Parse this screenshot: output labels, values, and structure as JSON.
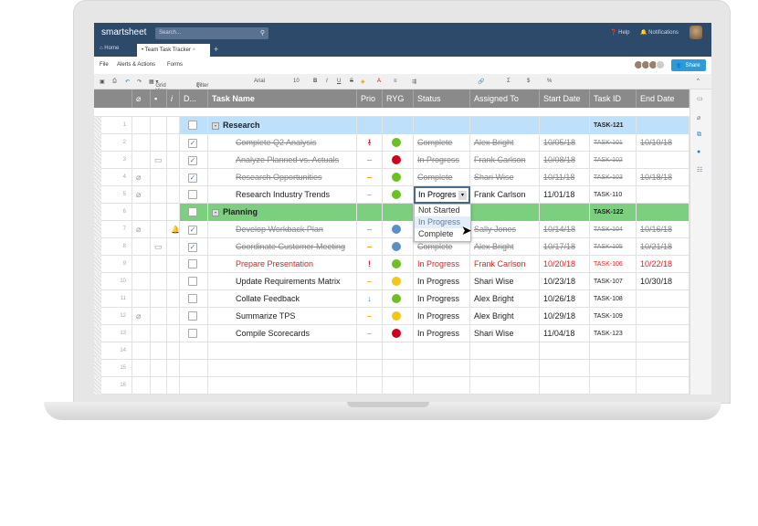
{
  "app": {
    "logo": "smartsheet",
    "search_placeholder": "Search...",
    "help": "Help",
    "notifications": "Notifications"
  },
  "tabs": {
    "home": "Home",
    "active": "Team Task Tracker",
    "add": "+"
  },
  "menu": [
    "File",
    "Alerts & Actions",
    "Forms"
  ],
  "share": "Share",
  "toolbar": {
    "view": "Grid View",
    "filter": "Filter",
    "font": "Arial",
    "size": "10"
  },
  "columns": [
    "D...",
    "Task Name",
    "Prio",
    "RYG",
    "Status",
    "Assigned To",
    "Start Date",
    "Task ID",
    "End Date"
  ],
  "colors": {
    "header": "#2e4a6a",
    "research_row": "#bfe0fb",
    "planning_row": "#7ccf7f",
    "share": "#2f9ad8",
    "green": "#6cc024",
    "red": "#d0021b",
    "yellow": "#f5c518",
    "blue": "#5b8fc7"
  },
  "rows": [
    {
      "n": "1",
      "task": "Research",
      "parent": "research",
      "task_id": "TASK-121"
    },
    {
      "n": "2",
      "task": "Complete Q2 Analysis",
      "done": true,
      "prio": "!",
      "ryg": "green",
      "status": "Complete",
      "assigned": "Alex Bright",
      "start": "10/05/18",
      "task_id": "TASK-101",
      "end": "10/10/18",
      "strike": true
    },
    {
      "n": "3",
      "task": "Analyze Planned vs. Actuals",
      "comment": true,
      "done": true,
      "prio": "–",
      "ryg": "red",
      "status": "In Progress",
      "assigned": "Frank Carlson",
      "start": "10/08/18",
      "task_id": "TASK-102",
      "end": "",
      "strike": true
    },
    {
      "n": "4",
      "task": "Research Opportunities",
      "attach": true,
      "done": true,
      "prio": "–",
      "ryg": "green",
      "status": "Complete",
      "assigned": "Shari Wise",
      "start": "10/11/18",
      "task_id": "TASK-103",
      "end": "10/18/18",
      "strike": true
    },
    {
      "n": "5",
      "task": "Research Industry Trends",
      "attach": true,
      "done": false,
      "prio": "–",
      "ryg": "green",
      "status": "In Progres",
      "assigned": "Frank Carlson",
      "start": "11/01/18",
      "task_id": "TASK-110",
      "end": "",
      "editing": true
    },
    {
      "n": "6",
      "task": "Planning",
      "parent": "planning",
      "task_id": "TASK-122"
    },
    {
      "n": "7",
      "task": "Develop Workback Plan",
      "attach": true,
      "bell": true,
      "done": true,
      "prio": "–",
      "ryg": "blue",
      "status": "",
      "assigned": "Sally Jones",
      "start": "10/14/18",
      "task_id": "TASK-104",
      "end": "10/16/18",
      "strike": true
    },
    {
      "n": "8",
      "task": "Coordinate Customer Meeting",
      "comment": true,
      "done": true,
      "prio": "–",
      "ryg": "blue",
      "status": "Complete",
      "assigned": "Alex Bright",
      "start": "10/17/18",
      "task_id": "TASK-105",
      "end": "10/21/18",
      "strike": true
    },
    {
      "n": "9",
      "task": "Prepare Presentation",
      "done": false,
      "prio": "!",
      "ryg": "green",
      "status": "In Progress",
      "assigned": "Frank Carlson",
      "start": "10/20/18",
      "task_id": "TASK-106",
      "end": "10/22/18",
      "red": true
    },
    {
      "n": "10",
      "task": "Update Requirements Matrix",
      "done": false,
      "prio": "–",
      "ryg": "yellow",
      "status": "In Progress",
      "assigned": "Shari Wise",
      "start": "10/23/18",
      "task_id": "TASK-107",
      "end": "10/30/18"
    },
    {
      "n": "11",
      "task": "Collate Feedback",
      "done": false,
      "prio": "↓",
      "ryg": "green",
      "status": "In Progress",
      "assigned": "Alex Bright",
      "start": "10/26/18",
      "task_id": "TASK-108",
      "end": ""
    },
    {
      "n": "12",
      "task": "Summarize TPS",
      "attach": true,
      "done": false,
      "prio": "–",
      "ryg": "yellow",
      "status": "In Progress",
      "assigned": "Alex Bright",
      "start": "10/29/18",
      "task_id": "TASK-109",
      "end": ""
    },
    {
      "n": "13",
      "task": "Compile Scorecards",
      "done": false,
      "prio": "–",
      "ryg": "red",
      "status": "In Progress",
      "assigned": "Shari Wise",
      "start": "11/04/18",
      "task_id": "TASK-123",
      "end": ""
    },
    {
      "n": "14"
    },
    {
      "n": "15"
    },
    {
      "n": "16"
    }
  ],
  "dropdown": {
    "options": [
      "Not Started",
      "In Progress",
      "Complete"
    ],
    "highlighted": "In Progress"
  }
}
